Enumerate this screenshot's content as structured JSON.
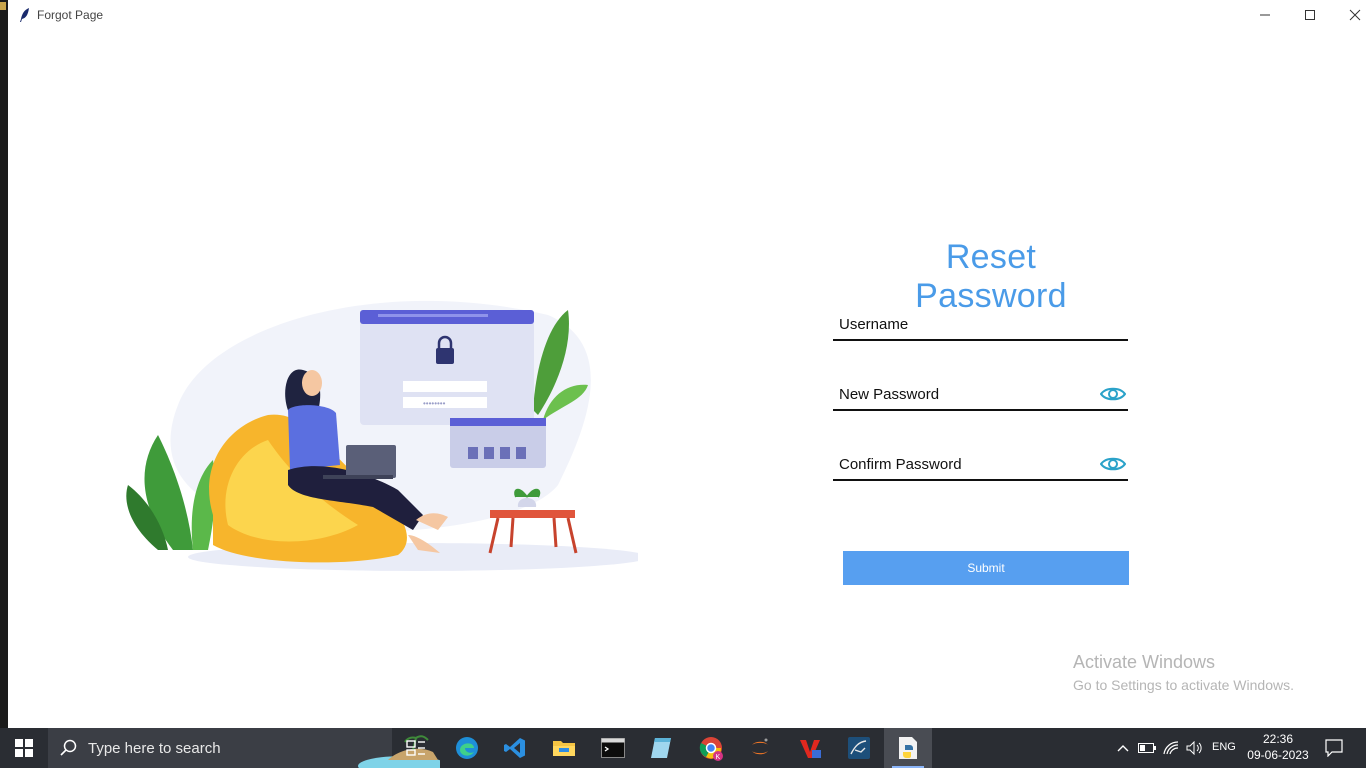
{
  "window": {
    "title": "Forgot Page",
    "icons": {
      "app": "feather-icon",
      "minimize": "minimize-icon",
      "maximize": "maximize-icon",
      "close": "close-icon"
    }
  },
  "form": {
    "title": "Reset Password",
    "username_placeholder": "Username",
    "new_password_placeholder": "New Password",
    "confirm_password_placeholder": "Confirm Password",
    "submit_label": "Submit",
    "accent_color": "#4a9be8",
    "button_color": "#579ff0"
  },
  "watermark": {
    "line1": "Activate Windows",
    "line2": "Go to Settings to activate Windows."
  },
  "taskbar": {
    "search_placeholder": "Type here to search",
    "apps": [
      "task-view-icon",
      "edge-icon",
      "vscode-icon",
      "file-explorer-icon",
      "terminal-icon",
      "notepad-icon",
      "chrome-icon",
      "jupyter-icon",
      "winrar-icon",
      "mysql-workbench-icon",
      "python-idle-icon"
    ],
    "language": "ENG",
    "time": "22:36",
    "date": "09-06-2023"
  }
}
